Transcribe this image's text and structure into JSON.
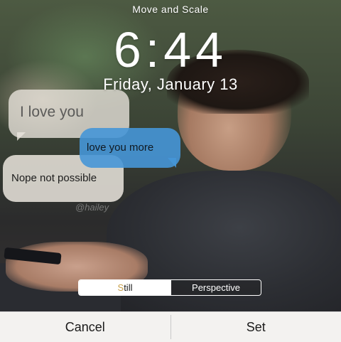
{
  "header": {
    "title": "Move and Scale"
  },
  "lock_screen": {
    "time": "6:44",
    "date": "Friday, January 13"
  },
  "wallpaper": {
    "bubbles": [
      {
        "text": "I love you"
      },
      {
        "text": "love you more"
      },
      {
        "text": "Nope not possible"
      }
    ],
    "watermark": "@hailey"
  },
  "toggle": {
    "still_first": "S",
    "still_rest": "till",
    "perspective": "Perspective",
    "selected": "Still"
  },
  "footer": {
    "cancel": "Cancel",
    "set": "Set"
  },
  "colors": {
    "bubble_blue": "#4696d7",
    "bar_bg": "#f3f2f0",
    "accent": "#c8a04a"
  }
}
